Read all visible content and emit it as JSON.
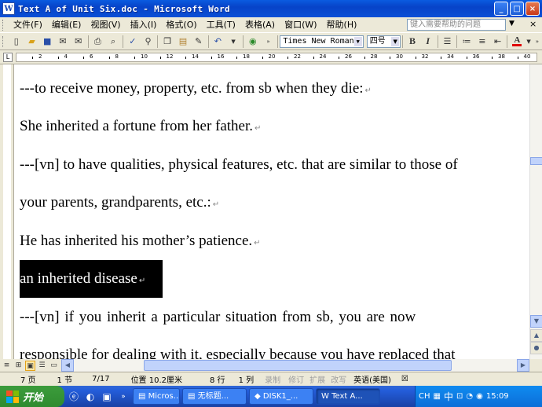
{
  "window": {
    "title": "Text A of Unit Six.doc - Microsoft Word",
    "minimize": "_",
    "maximize": "□",
    "close": "×"
  },
  "menu": {
    "items": [
      "文件(F)",
      "编辑(E)",
      "视图(V)",
      "插入(I)",
      "格式(O)",
      "工具(T)",
      "表格(A)",
      "窗口(W)",
      "帮助(H)"
    ],
    "help_placeholder": "键入需要帮助的问题"
  },
  "toolbar": {
    "font_name": "Times New Roman",
    "font_size": "四号",
    "bold": "B",
    "italic": "I",
    "font_color": "A"
  },
  "ruler": {
    "numbers": [
      "2",
      "4",
      "6",
      "8",
      "10",
      "12",
      "14",
      "16",
      "18",
      "20",
      "22",
      "24",
      "26",
      "28",
      "30",
      "32",
      "34",
      "36",
      "38",
      "40"
    ]
  },
  "document": {
    "lines": [
      "---to receive money, property, etc. from sb when they die:",
      "She inherited a fortune from her father.",
      "---[vn] to have qualities, physical features, etc. that are similar to those of",
      "your parents, grandparents, etc.:",
      "He has inherited his mother’s patience.",
      "an inherited disease",
      "---[vn]  if  you  inherit  a  particular  situation  from  sb,  you  are  now",
      "responsible for dealing with it, especially because you have replaced that"
    ],
    "para_mark": "↵"
  },
  "status": {
    "page": "7 页",
    "section": "1 节",
    "pages": "7/17",
    "position": "位置 10.2厘米",
    "line": "8 行",
    "column": "1 列",
    "rec": "录制",
    "trk": "修订",
    "ext": "扩展",
    "ovr": "改写",
    "language": "英语(美国)"
  },
  "taskbar": {
    "start": "开始",
    "tasks": [
      "Micros...",
      "无标题...",
      "DISK1_...",
      "Text A..."
    ],
    "active_task": 3,
    "ime": "CH",
    "ime2": "中",
    "clock": "15:09"
  }
}
